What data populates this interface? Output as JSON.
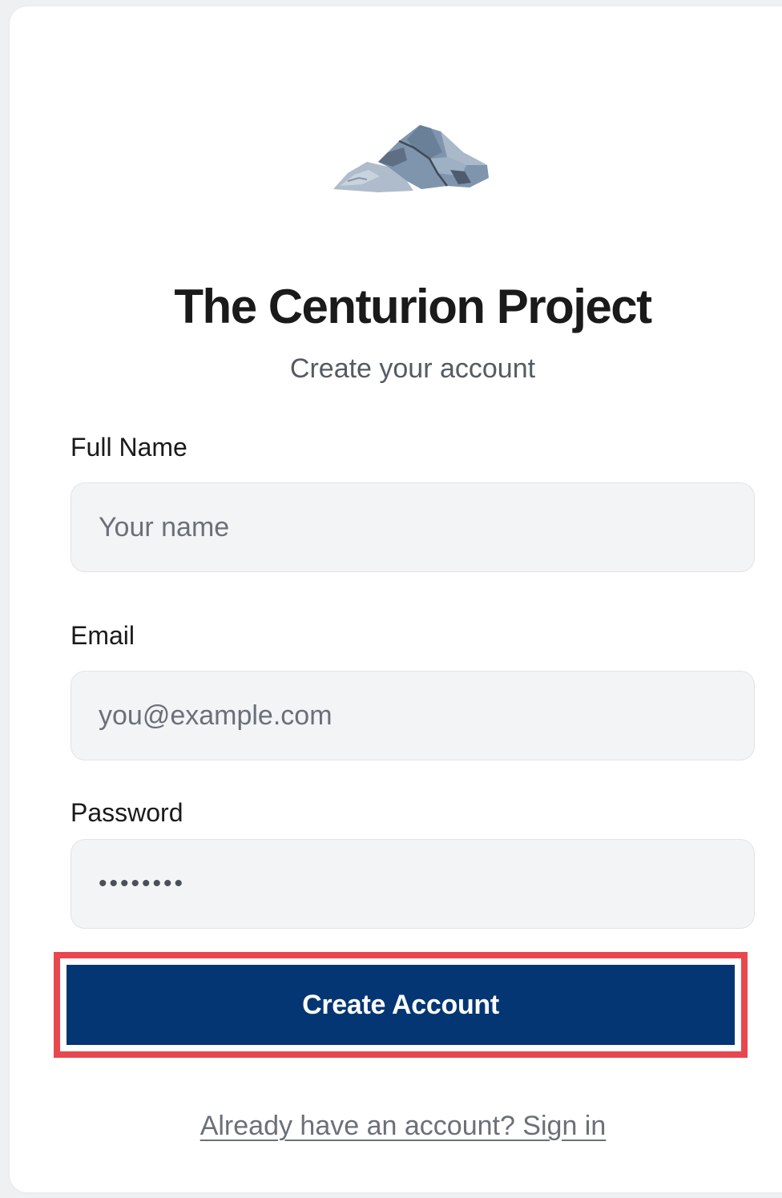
{
  "brand": {
    "logo_icon": "mountain-icon",
    "title": "The Centurion Project",
    "subtitle": "Create your account"
  },
  "form": {
    "full_name": {
      "label": "Full Name",
      "placeholder": "Your name",
      "value": ""
    },
    "email": {
      "label": "Email",
      "placeholder": "you@example.com",
      "value": ""
    },
    "password": {
      "label": "Password",
      "value": "••••••••"
    },
    "submit_label": "Create Account"
  },
  "footer": {
    "signin_link": "Already have an account? Sign in"
  },
  "colors": {
    "primary_button": "#033673",
    "highlight_border": "#e8474d",
    "input_background": "#f3f4f6"
  }
}
